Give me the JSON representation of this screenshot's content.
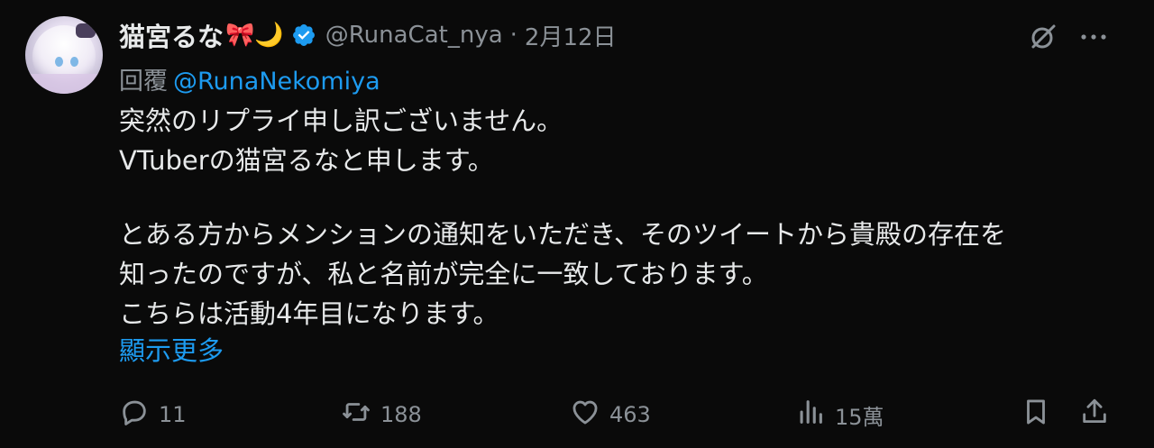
{
  "tweet": {
    "author_name": "猫宮るな",
    "author_emojis": "🎀🌙",
    "handle": "@RunaCat_nya",
    "separator": "·",
    "date": "2月12日",
    "reply_prefix": "回覆",
    "reply_mention": "@RunaNekomiya",
    "lines": [
      "突然のリプライ申し訳ございません。",
      "VTuberの猫宮るなと申します。",
      "",
      "とある方からメンションの通知をいただき、そのツイートから貴殿の存在を",
      "知ったのですが、私と名前が完全に一致しております。",
      "こちらは活動4年目になります。"
    ],
    "show_more": "顯示更多"
  },
  "actions": {
    "replies": "11",
    "retweets": "188",
    "likes": "463",
    "views": "15萬"
  },
  "icons": {
    "verified": "verified-badge-icon",
    "grok": "grok-icon",
    "more": "more-dots-icon",
    "reply": "reply-icon",
    "retweet": "retweet-icon",
    "like": "heart-icon",
    "views": "views-chart-icon",
    "bookmark": "bookmark-icon",
    "share": "share-icon"
  },
  "colors": {
    "background": "#0a0a0a",
    "text": "#e7e9ea",
    "muted": "#8b9197",
    "accent": "#1d9bf0"
  }
}
